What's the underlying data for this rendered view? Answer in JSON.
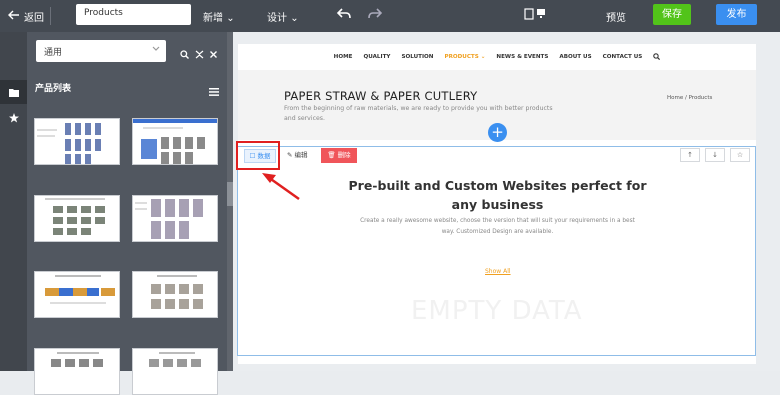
{
  "topbar": {
    "back_label": "返回",
    "page_name": "Products",
    "menu_add": "新增",
    "menu_design": "设计",
    "preview_label": "预览",
    "save_label": "保存",
    "publish_label": "发布"
  },
  "sidebar": {
    "category_value": "通用",
    "panel_title": "产品列表"
  },
  "site": {
    "nav_items": [
      "HOME",
      "QUALITY",
      "SOLUTION",
      "PRODUCTS",
      "NEWS & EVENTS",
      "ABOUT US",
      "CONTACT US"
    ],
    "hero_title": "PAPER STRAW & PAPER CUTLERY",
    "hero_subtitle": "From the beginning of raw materials, we are ready to provide you with better products and services.",
    "breadcrumb": "Home / Products"
  },
  "section_toolbar": {
    "data_label": "数据",
    "edit_label": "编辑",
    "delete_label": "删除"
  },
  "section": {
    "title": "Pre-built and Custom Websites perfect for any business",
    "description": "Create a really awesome website, choose the version that will suit your requirements in a best way. Customized Design are available.",
    "show_all": "Show All",
    "empty_text": "EMPTY DATA"
  },
  "colors": {
    "topbar": "#444a52",
    "save": "#52c41a",
    "publish": "#3a8ff0",
    "accent": "#f0a020",
    "delete": "#f0555a",
    "highlight": "#e02020"
  }
}
